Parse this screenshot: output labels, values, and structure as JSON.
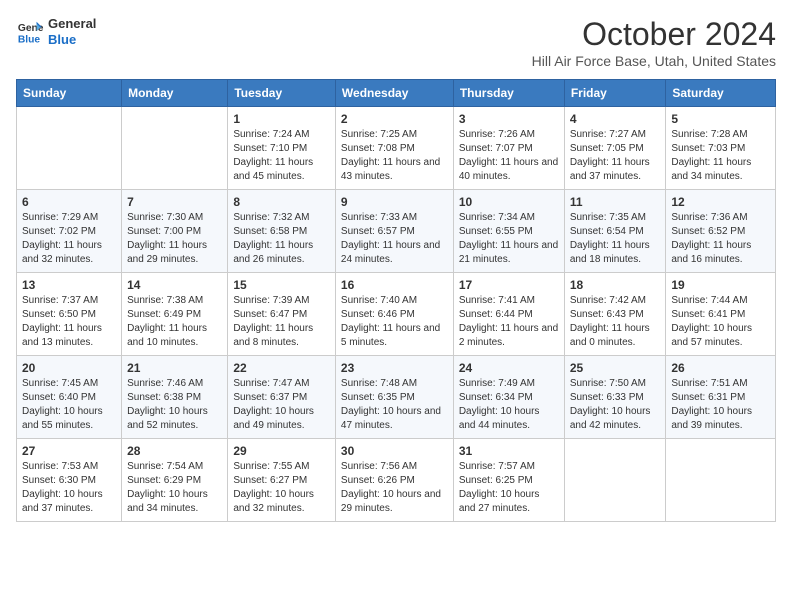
{
  "logo": {
    "line1": "General",
    "line2": "Blue"
  },
  "title": "October 2024",
  "subtitle": "Hill Air Force Base, Utah, United States",
  "days_of_week": [
    "Sunday",
    "Monday",
    "Tuesday",
    "Wednesday",
    "Thursday",
    "Friday",
    "Saturday"
  ],
  "weeks": [
    [
      {
        "num": "",
        "info": ""
      },
      {
        "num": "",
        "info": ""
      },
      {
        "num": "1",
        "info": "Sunrise: 7:24 AM\nSunset: 7:10 PM\nDaylight: 11 hours and 45 minutes."
      },
      {
        "num": "2",
        "info": "Sunrise: 7:25 AM\nSunset: 7:08 PM\nDaylight: 11 hours and 43 minutes."
      },
      {
        "num": "3",
        "info": "Sunrise: 7:26 AM\nSunset: 7:07 PM\nDaylight: 11 hours and 40 minutes."
      },
      {
        "num": "4",
        "info": "Sunrise: 7:27 AM\nSunset: 7:05 PM\nDaylight: 11 hours and 37 minutes."
      },
      {
        "num": "5",
        "info": "Sunrise: 7:28 AM\nSunset: 7:03 PM\nDaylight: 11 hours and 34 minutes."
      }
    ],
    [
      {
        "num": "6",
        "info": "Sunrise: 7:29 AM\nSunset: 7:02 PM\nDaylight: 11 hours and 32 minutes."
      },
      {
        "num": "7",
        "info": "Sunrise: 7:30 AM\nSunset: 7:00 PM\nDaylight: 11 hours and 29 minutes."
      },
      {
        "num": "8",
        "info": "Sunrise: 7:32 AM\nSunset: 6:58 PM\nDaylight: 11 hours and 26 minutes."
      },
      {
        "num": "9",
        "info": "Sunrise: 7:33 AM\nSunset: 6:57 PM\nDaylight: 11 hours and 24 minutes."
      },
      {
        "num": "10",
        "info": "Sunrise: 7:34 AM\nSunset: 6:55 PM\nDaylight: 11 hours and 21 minutes."
      },
      {
        "num": "11",
        "info": "Sunrise: 7:35 AM\nSunset: 6:54 PM\nDaylight: 11 hours and 18 minutes."
      },
      {
        "num": "12",
        "info": "Sunrise: 7:36 AM\nSunset: 6:52 PM\nDaylight: 11 hours and 16 minutes."
      }
    ],
    [
      {
        "num": "13",
        "info": "Sunrise: 7:37 AM\nSunset: 6:50 PM\nDaylight: 11 hours and 13 minutes."
      },
      {
        "num": "14",
        "info": "Sunrise: 7:38 AM\nSunset: 6:49 PM\nDaylight: 11 hours and 10 minutes."
      },
      {
        "num": "15",
        "info": "Sunrise: 7:39 AM\nSunset: 6:47 PM\nDaylight: 11 hours and 8 minutes."
      },
      {
        "num": "16",
        "info": "Sunrise: 7:40 AM\nSunset: 6:46 PM\nDaylight: 11 hours and 5 minutes."
      },
      {
        "num": "17",
        "info": "Sunrise: 7:41 AM\nSunset: 6:44 PM\nDaylight: 11 hours and 2 minutes."
      },
      {
        "num": "18",
        "info": "Sunrise: 7:42 AM\nSunset: 6:43 PM\nDaylight: 11 hours and 0 minutes."
      },
      {
        "num": "19",
        "info": "Sunrise: 7:44 AM\nSunset: 6:41 PM\nDaylight: 10 hours and 57 minutes."
      }
    ],
    [
      {
        "num": "20",
        "info": "Sunrise: 7:45 AM\nSunset: 6:40 PM\nDaylight: 10 hours and 55 minutes."
      },
      {
        "num": "21",
        "info": "Sunrise: 7:46 AM\nSunset: 6:38 PM\nDaylight: 10 hours and 52 minutes."
      },
      {
        "num": "22",
        "info": "Sunrise: 7:47 AM\nSunset: 6:37 PM\nDaylight: 10 hours and 49 minutes."
      },
      {
        "num": "23",
        "info": "Sunrise: 7:48 AM\nSunset: 6:35 PM\nDaylight: 10 hours and 47 minutes."
      },
      {
        "num": "24",
        "info": "Sunrise: 7:49 AM\nSunset: 6:34 PM\nDaylight: 10 hours and 44 minutes."
      },
      {
        "num": "25",
        "info": "Sunrise: 7:50 AM\nSunset: 6:33 PM\nDaylight: 10 hours and 42 minutes."
      },
      {
        "num": "26",
        "info": "Sunrise: 7:51 AM\nSunset: 6:31 PM\nDaylight: 10 hours and 39 minutes."
      }
    ],
    [
      {
        "num": "27",
        "info": "Sunrise: 7:53 AM\nSunset: 6:30 PM\nDaylight: 10 hours and 37 minutes."
      },
      {
        "num": "28",
        "info": "Sunrise: 7:54 AM\nSunset: 6:29 PM\nDaylight: 10 hours and 34 minutes."
      },
      {
        "num": "29",
        "info": "Sunrise: 7:55 AM\nSunset: 6:27 PM\nDaylight: 10 hours and 32 minutes."
      },
      {
        "num": "30",
        "info": "Sunrise: 7:56 AM\nSunset: 6:26 PM\nDaylight: 10 hours and 29 minutes."
      },
      {
        "num": "31",
        "info": "Sunrise: 7:57 AM\nSunset: 6:25 PM\nDaylight: 10 hours and 27 minutes."
      },
      {
        "num": "",
        "info": ""
      },
      {
        "num": "",
        "info": ""
      }
    ]
  ]
}
